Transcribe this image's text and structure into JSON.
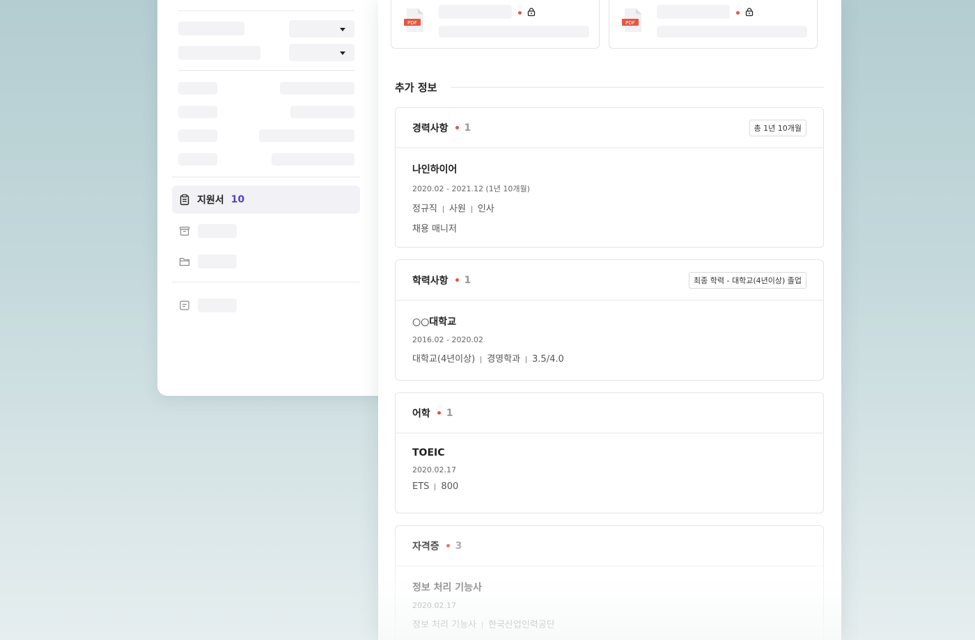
{
  "sidebar": {
    "active_nav": {
      "label": "지원서",
      "count": "10"
    },
    "nav_icons": [
      "clipboard-icon",
      "archive-icon",
      "folder-icon",
      "note-icon"
    ]
  },
  "files": [
    {
      "type_label": "PDF"
    },
    {
      "type_label": "PDF"
    }
  ],
  "section": {
    "title": "추가 정보"
  },
  "cards": {
    "career": {
      "title": "경력사항",
      "count": "1",
      "badge": "총 1년 10개월",
      "item": {
        "name": "나인하이어",
        "period": "2020.02 - 2021.12 (1년 10개월)",
        "meta": [
          "정규직",
          "사원",
          "인사"
        ],
        "role": "채용 매니저"
      }
    },
    "education": {
      "title": "학력사항",
      "count": "1",
      "badge": "최종 학력 - 대학교(4년이상) 졸업",
      "item": {
        "name": "○○대학교",
        "period": "2016.02 - 2020.02",
        "meta": [
          "대학교(4년이상)",
          "경영학과",
          "3.5/4.0"
        ]
      }
    },
    "language": {
      "title": "어학",
      "count": "1",
      "item": {
        "name": "TOEIC",
        "period": "2020.02.17",
        "meta": [
          "ETS",
          "800"
        ]
      }
    },
    "license": {
      "title": "자격증",
      "count": "3",
      "item": {
        "name": "정보 처리 기능사",
        "period": "2020.02.17",
        "meta": [
          "정보 처리 기능사",
          "한국산업인력공단"
        ]
      }
    }
  },
  "colors": {
    "accent": "#5b3fc2",
    "dot": "#e4553c",
    "pdf": "#e8553d"
  }
}
